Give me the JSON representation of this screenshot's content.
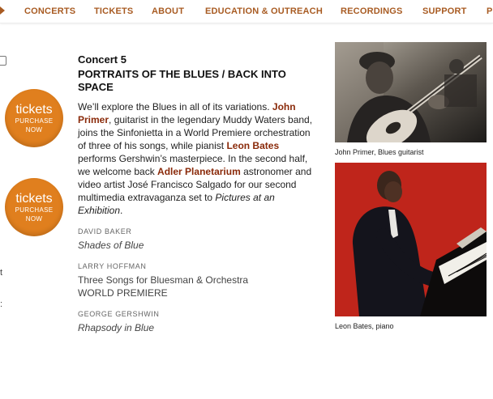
{
  "nav": {
    "items": [
      {
        "label": "CONCERTS"
      },
      {
        "label": "TICKETS"
      },
      {
        "label": "ABOUT"
      },
      {
        "label": "EDUCATION & OUTREACH"
      },
      {
        "label": "RECORDINGS"
      },
      {
        "label": "SUPPORT"
      },
      {
        "label": "P"
      }
    ]
  },
  "sidebar": {
    "badges": [
      {
        "title": "tickets",
        "line1": "PURCHASE",
        "line2": "NOW"
      },
      {
        "title": "tickets",
        "line1": "PURCHASE",
        "line2": "NOW"
      }
    ],
    "fragments": [
      "t",
      ":"
    ]
  },
  "concert": {
    "number": "Concert 5",
    "title": "PORTRAITS OF THE BLUES / BACK INTO SPACE",
    "description": {
      "p1": "We’ll explore the Blues in all of its variations. ",
      "link1": "John Primer",
      "p2": ", guitarist in the legendary Muddy Waters band, joins the Sinfonietta in a World Premiere orchestration of three of his songs, while pianist ",
      "link2": "Leon Bates",
      "p3": " performs Gershwin’s masterpiece. In the second half, we welcome back ",
      "link3": "Adler Planetarium",
      "p4": " astronomer and video artist José Francisco Salgado for our second multimedia extravaganza set to ",
      "italic": "Pictures at an Exhibition",
      "p5": "."
    },
    "program": [
      {
        "composer": "DAVID BAKER",
        "work": "Shades of Blue",
        "italic": true,
        "note": ""
      },
      {
        "composer": "LARRY HOFFMAN",
        "work": "Three Songs for Bluesman & Orchestra",
        "italic": false,
        "note": "WORLD PREMIERE"
      },
      {
        "composer": "GEORGE GERSHWIN",
        "work": "Rhapsody in Blue",
        "italic": true,
        "note": ""
      }
    ]
  },
  "photos": [
    {
      "caption": "John Primer, Blues guitarist"
    },
    {
      "caption": "Leon Bates, piano"
    }
  ],
  "colors": {
    "nav": "#a85b22",
    "badge": "#e07f1e",
    "link": "#8a2a0a",
    "piano_photo_bg": "#c8281e"
  }
}
